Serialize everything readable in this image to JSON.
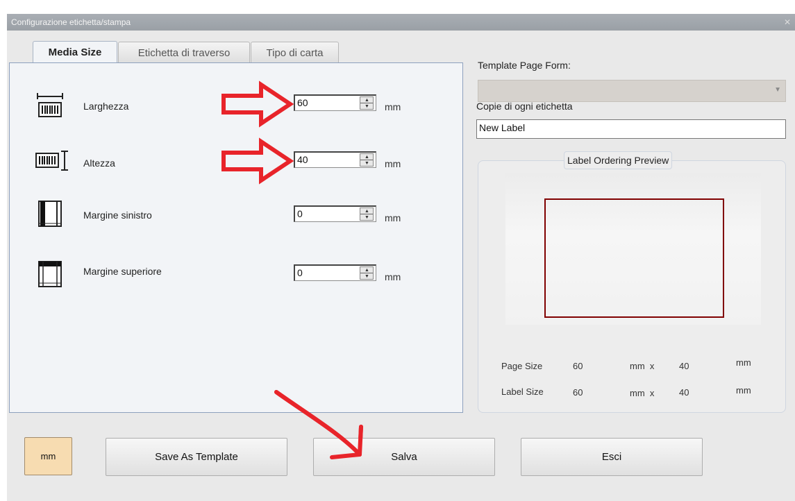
{
  "window": {
    "title": "Configurazione etichetta/stampa",
    "close_glyph": "✕"
  },
  "tabs": [
    {
      "label": "Media Size"
    },
    {
      "label": "Etichetta di traverso"
    },
    {
      "label": "Tipo di carta"
    }
  ],
  "rows": [
    {
      "label": "Larghezza",
      "value": "60",
      "unit": "mm",
      "icon": "width-barcode-icon"
    },
    {
      "label": "Altezza",
      "value": "40",
      "unit": "mm",
      "icon": "height-barcode-icon"
    },
    {
      "label": "Margine sinistro",
      "value": "0",
      "unit": "mm",
      "icon": "left-margin-icon"
    },
    {
      "label": "Margine superiore",
      "value": "0",
      "unit": "mm",
      "icon": "top-margin-icon"
    }
  ],
  "right": {
    "template_label": "Template Page Form:",
    "template_value": "",
    "copies_label": "Copie di ogni etichetta",
    "copies_value": "New Label",
    "preview_title": "Label Ordering Preview",
    "page_size": {
      "label": "Page Size",
      "w": "60",
      "sep": "mm  x",
      "h": "40",
      "unit": "mm"
    },
    "label_size": {
      "label": "Label Size",
      "w": "60",
      "sep": "mm  x",
      "h": "40",
      "unit": "mm"
    }
  },
  "buttons": {
    "mm": "mm",
    "save_template": "Save As Template",
    "save": "Salva",
    "exit": "Esci"
  },
  "colors": {
    "annotation": "#e8242a",
    "preview_border": "#800000",
    "mm_button": "#f7dcb1"
  }
}
